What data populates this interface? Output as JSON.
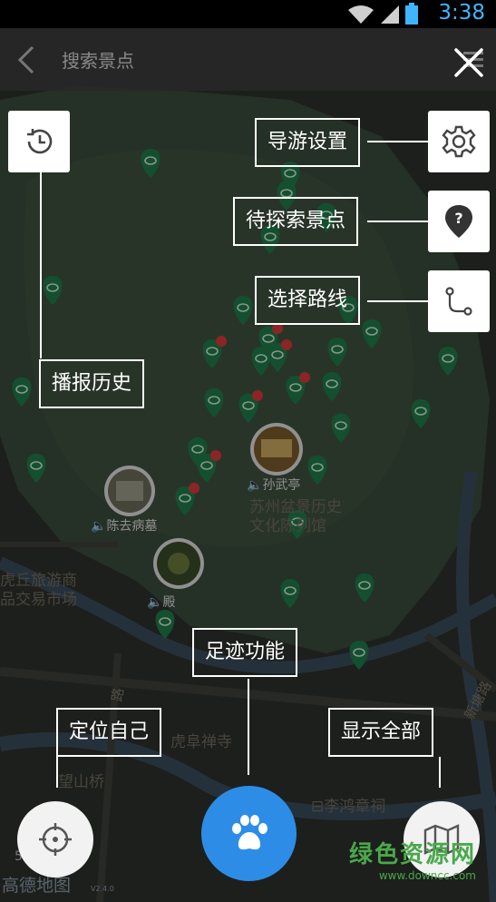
{
  "status_bar": {
    "time": "3:38"
  },
  "app_bar": {
    "title": "搜索景点"
  },
  "map": {
    "labels": {
      "sun_wu_ting": "孙武亭",
      "museum_line1": "苏州盆景历史",
      "museum_line2": "文化陈列馆",
      "chen_qubing_tomb": "陈去病墓",
      "hall": "殿",
      "market_line1": "虎丘旅游商",
      "market_line2": "品交易市场",
      "hu_pan_temple": "虎阜禅寺",
      "wangshan_bridge": "望山桥",
      "li_hongzhang": "李鸿章祠",
      "xintang_road": "新塘路",
      "road_lu": "路"
    },
    "amap_logo": "高德地图",
    "amap_version": "V2.4.0",
    "scale_hint": "5"
  },
  "guide": {
    "broadcast_history": "播报历史",
    "guide_settings": "导游设置",
    "to_explore": "待探索景点",
    "choose_route": "选择路线",
    "footprint": "足迹功能",
    "locate_self": "定位自己",
    "show_all": "显示全部"
  },
  "watermark": {
    "title": "绿色资源网",
    "url": "www.downcc.com"
  },
  "colors": {
    "accent": "#2d8de6",
    "pin_green": "#1f7a4a",
    "badge_red": "#d83a3a"
  }
}
